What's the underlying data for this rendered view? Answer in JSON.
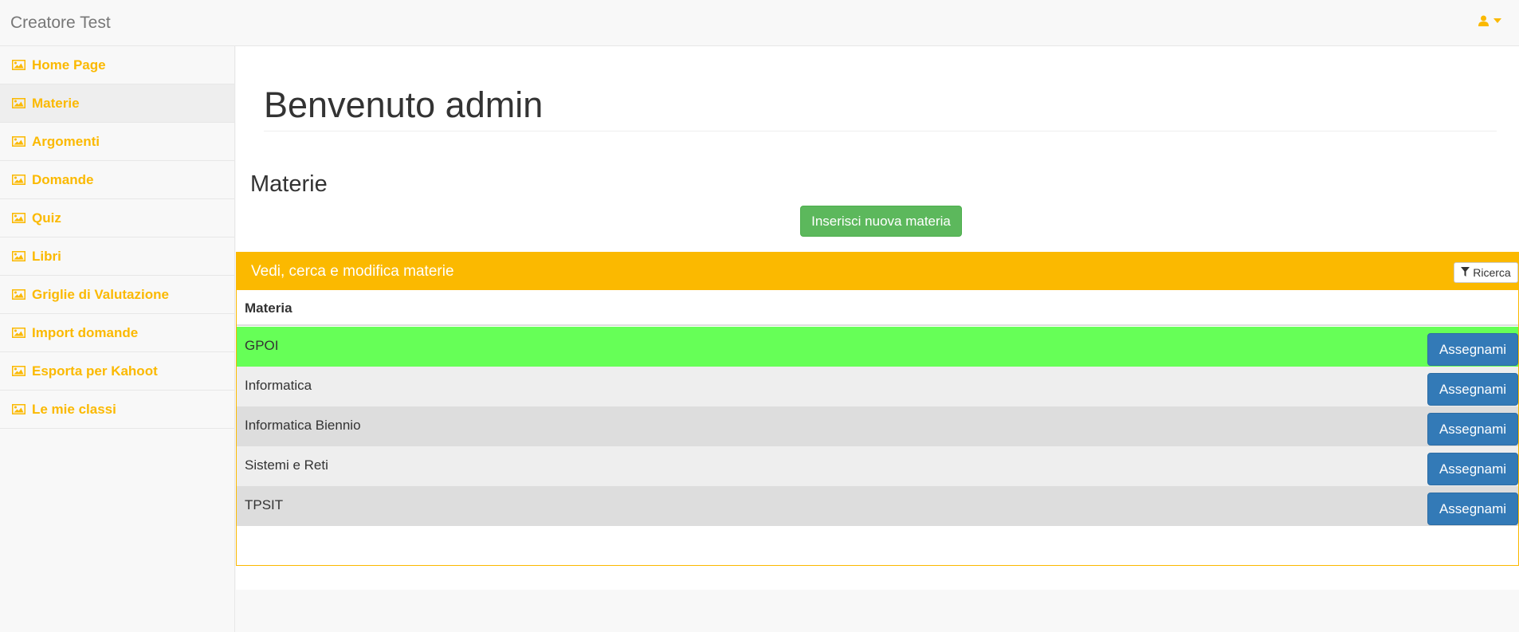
{
  "app": {
    "title": "Creatore Test"
  },
  "colors": {
    "accent": "#fbb900",
    "success": "#5cb85c",
    "primary": "#337ab7",
    "row_highlight": "#66ff57",
    "row_odd": "#eeeeee",
    "row_even": "#dddddd"
  },
  "header": {
    "user_icon": "user-icon",
    "caret_icon": "caret-down-icon"
  },
  "sidebar": {
    "items": [
      {
        "label": "Home Page",
        "icon": "image-icon"
      },
      {
        "label": "Materie",
        "icon": "image-icon",
        "active": true
      },
      {
        "label": "Argomenti",
        "icon": "image-icon"
      },
      {
        "label": "Domande",
        "icon": "image-icon"
      },
      {
        "label": "Quiz",
        "icon": "image-icon"
      },
      {
        "label": "Libri",
        "icon": "image-icon"
      },
      {
        "label": "Griglie di Valutazione",
        "icon": "image-icon"
      },
      {
        "label": "Import domande",
        "icon": "image-icon"
      },
      {
        "label": "Esporta per Kahoot",
        "icon": "image-icon"
      },
      {
        "label": "Le mie classi",
        "icon": "image-icon"
      }
    ]
  },
  "main": {
    "welcome": "Benvenuto admin",
    "section_title": "Materie",
    "new_button": "Inserisci nuova materia",
    "panel": {
      "title": "Vedi, cerca e modifica materie",
      "search_label": "Ricerca",
      "column_header": "Materia",
      "rows": [
        {
          "name": "GPOI",
          "action": "Assegnami"
        },
        {
          "name": "Informatica",
          "action": "Assegnami"
        },
        {
          "name": "Informatica Biennio",
          "action": "Assegnami"
        },
        {
          "name": "Sistemi e Reti",
          "action": "Assegnami"
        },
        {
          "name": "TPSIT",
          "action": "Assegnami"
        }
      ]
    }
  }
}
